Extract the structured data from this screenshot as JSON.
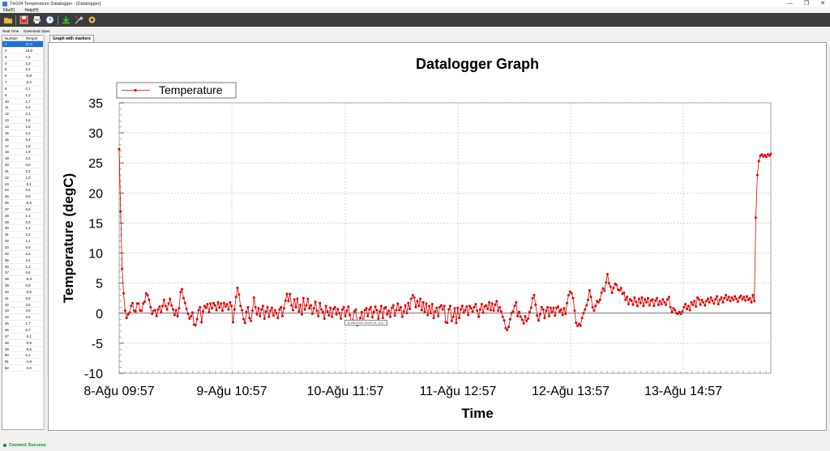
{
  "window": {
    "title": "TH104 Temperature Datalogger - [Datalogger]",
    "controls": [
      "—",
      "❐",
      "✕"
    ]
  },
  "menu": {
    "items": [
      "File(F)",
      "Help(H)"
    ]
  },
  "toolbar": {
    "icons": [
      "open-folder-icon",
      "save-icon",
      "print-icon",
      "clock-icon",
      "download-icon",
      "tools-icon",
      "settings-icon"
    ]
  },
  "left": {
    "tabs": [
      "Real Time",
      "Download Open"
    ],
    "columns": [
      "Number",
      "Temprtr"
    ],
    "rows": [
      [
        "1",
        "27,3"
      ],
      [
        "2",
        "16,9"
      ],
      [
        "3",
        "7,4"
      ],
      [
        "4",
        "3,3"
      ],
      [
        "5",
        "0,4"
      ],
      [
        "6",
        "-0,8"
      ],
      [
        "7",
        "-0,2"
      ],
      [
        "8",
        "0,1"
      ],
      [
        "9",
        "1,2"
      ],
      [
        "10",
        "1,7"
      ],
      [
        "11",
        "0,4"
      ],
      [
        "12",
        "0,3"
      ],
      [
        "13",
        "1,6"
      ],
      [
        "14",
        "1,6"
      ],
      [
        "15",
        "0,4"
      ],
      [
        "16",
        "0,4"
      ],
      [
        "17",
        "1,6"
      ],
      [
        "18",
        "1,9"
      ],
      [
        "19",
        "3,3"
      ],
      [
        "20",
        "3,0"
      ],
      [
        "21",
        "2,2"
      ],
      [
        "22",
        "1,0"
      ],
      [
        "23",
        "-0,1"
      ],
      [
        "24",
        "0,4"
      ],
      [
        "25",
        "0,5"
      ],
      [
        "26",
        "-0,5"
      ],
      [
        "27",
        "0,6"
      ],
      [
        "28",
        "1,1"
      ],
      [
        "29",
        "0,2"
      ],
      [
        "30",
        "1,2"
      ],
      [
        "31",
        "2,2"
      ],
      [
        "32",
        "1,2"
      ],
      [
        "33",
        "0,6"
      ],
      [
        "34",
        "1,6"
      ],
      [
        "35",
        "2,4"
      ],
      [
        "36",
        "1,3"
      ],
      [
        "37",
        "0,6"
      ],
      [
        "38",
        "-0,3"
      ],
      [
        "39",
        "0,5"
      ],
      [
        "40",
        "-0,5"
      ],
      [
        "41",
        "0,8"
      ],
      [
        "42",
        "3,5"
      ],
      [
        "43",
        "4,0"
      ],
      [
        "44",
        "2,5"
      ],
      [
        "45",
        "1,7"
      ],
      [
        "46",
        "0,7"
      ],
      [
        "47",
        "-0,1"
      ],
      [
        "48",
        "-0,9"
      ],
      [
        "49",
        "-0,5"
      ],
      [
        "50",
        "0,1"
      ],
      [
        "51",
        "-1,9"
      ],
      [
        "52",
        "-2,0"
      ]
    ]
  },
  "graph": {
    "tab": "Graph with markers",
    "tooltip": "10.08.2023 15:57:01 -0,3 °"
  },
  "status": {
    "text": "Connect Success"
  },
  "chart_data": {
    "type": "line",
    "title": "Datalogger Graph",
    "xlabel": "Time",
    "ylabel": "Temperature (degC)",
    "ylim": [
      -10,
      35
    ],
    "yticks": [
      "35",
      "30",
      "25",
      "20",
      "15",
      "10",
      "5",
      "0",
      "-5",
      "-10"
    ],
    "xticks": [
      "8-Ağu 09:57",
      "9-Ağu 10:57",
      "10-Ağu 11:57",
      "11-Ağu 12:57",
      "12-Ağu 13:57",
      "13-Ağu 14:57"
    ],
    "grid": true,
    "legend": "top-left",
    "series": [
      {
        "name": "Temperature",
        "color": "#e00000",
        "values": [
          27.3,
          16.9,
          7.4,
          3.3,
          0.4,
          -0.8,
          -0.2,
          0.1,
          1.2,
          1.7,
          0.4,
          0.3,
          1.6,
          1.6,
          0.4,
          0.4,
          1.6,
          1.9,
          3.3,
          3.0,
          2.2,
          1.0,
          -0.1,
          0.4,
          0.5,
          -0.5,
          0.6,
          1.1,
          0.2,
          1.2,
          2.2,
          1.2,
          0.6,
          1.6,
          2.4,
          1.3,
          0.6,
          -0.3,
          0.5,
          -0.5,
          0.8,
          3.5,
          4.0,
          2.5,
          1.7,
          0.7,
          -0.1,
          -0.9,
          -0.5,
          0.1,
          -1.9,
          -2.0,
          -1.0,
          0.5,
          1.0,
          -1.5,
          0.3,
          1.2,
          0.9,
          1.5,
          0.2,
          1.6,
          0.8,
          1.7,
          1.3,
          0.5,
          1.8,
          0.9,
          1.6,
          0.4,
          1.7,
          1.1,
          1.5,
          0.6,
          1.8,
          1.2,
          -1.5,
          0.6,
          2.7,
          4.2,
          3.1,
          1.2,
          0.5,
          -1.0,
          -1.6,
          0.2,
          1.0,
          -0.8,
          -1.3,
          0.4,
          2.6,
          1.0,
          -0.2,
          0.8,
          -0.5,
          0.6,
          1.2,
          -0.9,
          0.3,
          1.0,
          -0.6,
          0.4,
          0.9,
          -0.4,
          0.5,
          0.0,
          -0.8,
          0.6,
          1.0,
          -0.5,
          0.8,
          2.1,
          3.2,
          2.0,
          3.2,
          1.3,
          0.5,
          2.3,
          1.0,
          2.4,
          0.3,
          1.4,
          -0.2,
          2.5,
          0.6,
          1.3,
          2.4,
          0.8,
          1.3,
          -0.1,
          0.8,
          1.9,
          0.4,
          -0.5,
          1.7,
          0.6,
          0.2,
          -0.9,
          1.2,
          0.3,
          -0.4,
          0.9,
          -0.6,
          0.7,
          1.0,
          -0.2,
          0.7,
          0.0,
          -0.9,
          0.6,
          1.0,
          -0.5,
          0.4,
          1.1,
          -0.3,
          -1.5,
          -1.2,
          0.3,
          0.6,
          -2.0,
          -1.4,
          -0.8,
          0.2,
          -1.6,
          0.5,
          0.8,
          -0.5,
          0.6,
          1.0,
          -0.7,
          0.2,
          1.1,
          0.5,
          -0.9,
          0.3,
          1.2,
          -0.8,
          0.8,
          1.0,
          -0.2,
          0.4,
          -0.6,
          0.9,
          1.3,
          -0.4,
          0.5,
          1.6,
          0.5,
          1.0,
          -0.6,
          0.3,
          1.3,
          0.0,
          1.7,
          0.7,
          2.4,
          3.0,
          2.6,
          1.0,
          2.0,
          1.2,
          2.4,
          0.5,
          1.8,
          0.2,
          1.6,
          -0.3,
          1.2,
          0.0,
          1.5,
          -0.8,
          0.3,
          0.9,
          -0.5,
          1.0,
          1.3,
          0.6,
          1.2,
          -1.5,
          -1.6,
          0.6,
          1.2,
          -1.3,
          -0.6,
          0.8,
          -1.6,
          0.9,
          -0.8,
          0.6,
          1.2,
          0.1,
          0.5,
          1.1,
          -0.3,
          1.2,
          0.8,
          0.3,
          1.0,
          1.5,
          0.4,
          -0.6,
          0.6,
          1.5,
          0.1,
          1.1,
          1.3,
          0.7,
          1.8,
          0.5,
          1.6,
          0.4,
          1.4,
          2.0,
          0.4,
          1.0,
          0.3,
          -0.6,
          -1.2,
          -2.5,
          -2.8,
          -2.3,
          -1.0,
          0.0,
          0.3,
          1.2,
          1.8,
          -0.5,
          0.2,
          -0.6,
          -1.1,
          -1.7,
          -0.5,
          -1.3,
          -0.9,
          0.2,
          0.9,
          2.5,
          3.0,
          1.4,
          -0.4,
          -1.2,
          -0.2,
          1.0,
          0.6,
          -0.8,
          0.4,
          1.0,
          -0.5,
          0.9,
          0.2,
          0.9,
          -0.4,
          0.9,
          1.1,
          0.3,
          0.6,
          -0.3,
          0.8,
          -0.1,
          1.7,
          3.0,
          3.6,
          3.3,
          2.5,
          0.4,
          -1.6,
          -2.1,
          -1.8,
          -2.1,
          -0.8,
          0.0,
          0.6,
          1.3,
          2.2,
          3.8,
          2.7,
          1.0,
          0.4,
          1.2,
          2.0,
          1.8,
          2.2,
          3.4,
          4.1,
          3.7,
          5.1,
          6.5,
          5.0,
          4.4,
          3.4,
          4.2,
          4.9,
          4.7,
          3.9,
          3.8,
          4.2,
          3.2,
          3.4,
          2.2,
          2.7,
          1.5,
          2.3,
          2.1,
          1.4,
          2.6,
          1.9,
          1.2,
          2.4,
          1.7,
          2.6,
          1.2,
          2.3,
          1.8,
          2.5,
          1.3,
          2.1,
          2.3,
          1.2,
          2.1,
          2.5,
          1.4,
          2.0,
          1.5,
          2.3,
          1.8,
          1.4,
          2.3,
          2.7,
          1.0,
          0.2,
          0.8,
          0.5,
          0.0,
          -0.1,
          0.2,
          -0.1,
          0.3,
          1.0,
          1.5,
          0.7,
          1.2,
          0.5,
          1.8,
          1.4,
          2.0,
          1.1,
          2.6,
          2.3,
          1.4,
          2.2,
          1.8,
          1.3,
          2.0,
          2.4,
          1.8,
          2.6,
          2.1,
          1.6,
          2.3,
          2.8,
          1.5,
          2.2,
          2.6,
          1.8,
          2.5,
          3.0,
          2.2,
          2.7,
          2.0,
          2.6,
          2.2,
          2.8,
          2.4,
          1.9,
          2.6,
          2.9,
          2.3,
          2.7,
          2.1,
          2.8,
          2.2,
          2.5,
          1.8,
          3.0,
          2.0,
          15.9,
          23.0,
          25.3,
          26.2,
          26.4,
          26.1,
          26.3,
          26.0,
          26.4,
          26.2,
          26.5
        ]
      }
    ]
  }
}
